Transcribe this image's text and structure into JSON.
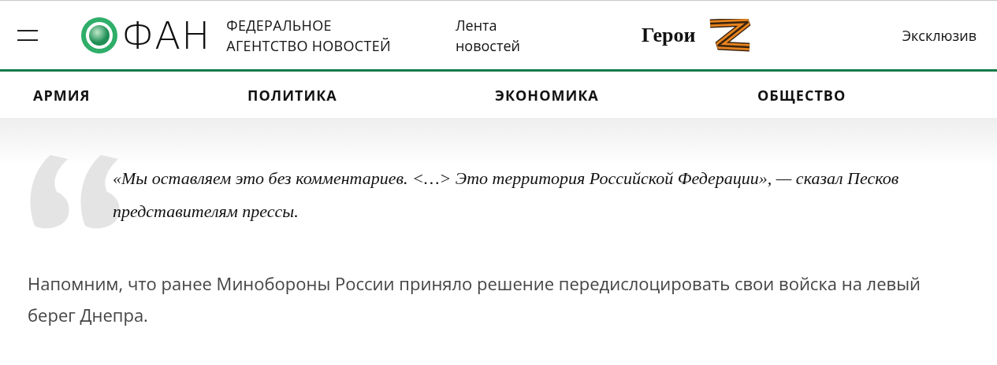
{
  "header": {
    "logo_text": "ФАН",
    "logo_subtitle": [
      "ФЕДЕРАЛЬНОЕ",
      "АГЕНТСТВО НОВОСТЕЙ"
    ],
    "news_feed": "Лента новостей",
    "heroes": "Герои",
    "exclusive": "Эксклюзив"
  },
  "nav": [
    "АРМИЯ",
    "ПОЛИТИКА",
    "ЭКОНОМИКА",
    "ОБЩЕСТВО"
  ],
  "quote": {
    "text": "«Мы оставляем это без комментариев. <…> Это территория Российской Федерации», — сказал Песков представителям прессы."
  },
  "paragraph": "Напомним, что ранее Минобороны России приняло решение передислоцировать свои войска на левый берег Днепра."
}
